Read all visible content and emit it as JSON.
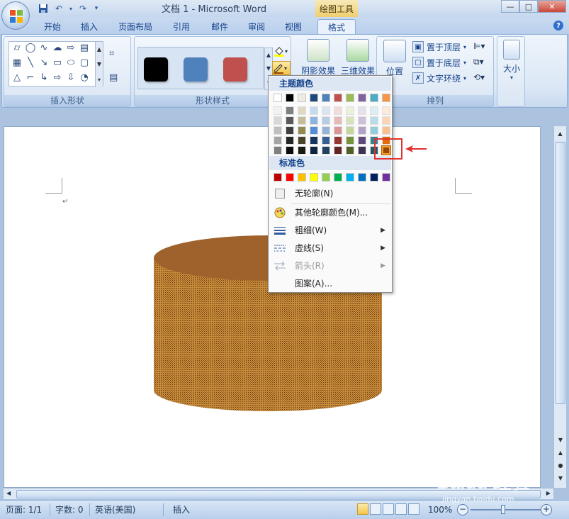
{
  "window": {
    "title": "文档 1 - Microsoft Word",
    "context_tab_title": "绘图工具",
    "controls": [
      "—",
      "□",
      "✕"
    ]
  },
  "tabs": [
    {
      "label": "开始"
    },
    {
      "label": "插入"
    },
    {
      "label": "页面布局"
    },
    {
      "label": "引用"
    },
    {
      "label": "邮件"
    },
    {
      "label": "审阅"
    },
    {
      "label": "视图"
    },
    {
      "label": "格式"
    }
  ],
  "ribbon": {
    "insert_shapes_label": "插入形状",
    "shape_styles_label": "形状样式",
    "arrange_label": "排列",
    "shadow_effects": "阴影效果",
    "threed_effects": "三维效果",
    "position": "位置",
    "bring_to_front": "置于顶层",
    "send_to_back": "置于底层",
    "text_wrapping": "文字环绕",
    "size": "大小",
    "style_swatches": [
      "#000000",
      "#4f81bd",
      "#c0504d"
    ]
  },
  "outline_menu": {
    "theme_colors_header": "主题颜色",
    "standard_colors_header": "标准色",
    "theme_top_row": [
      "#ffffff",
      "#000000",
      "#eeece1",
      "#1f497d",
      "#4f81bd",
      "#c0504d",
      "#9bbb59",
      "#8064a2",
      "#4bacc6",
      "#f79646"
    ],
    "theme_columns": [
      [
        "#f2f2f2",
        "#d8d8d8",
        "#bfbfbf",
        "#a5a5a5",
        "#7f7f7f"
      ],
      [
        "#7f7f7f",
        "#595959",
        "#3f3f3f",
        "#262626",
        "#0c0c0c"
      ],
      [
        "#ddd9c3",
        "#c4bd97",
        "#938953",
        "#494429",
        "#1d1b10"
      ],
      [
        "#c6d9f0",
        "#8db3e2",
        "#548dd4",
        "#17365d",
        "#0f243e"
      ],
      [
        "#dbe5f1",
        "#b8cce4",
        "#95b3d7",
        "#366092",
        "#244061"
      ],
      [
        "#f2dcdb",
        "#e5b9b7",
        "#d99694",
        "#953734",
        "#632423"
      ],
      [
        "#ebf1dd",
        "#d7e3bc",
        "#c3d69b",
        "#76923c",
        "#4f6128"
      ],
      [
        "#e5e0ec",
        "#ccc1d9",
        "#b2a2c7",
        "#5f497a",
        "#3f3151"
      ],
      [
        "#dbeef3",
        "#b7dde8",
        "#92cddc",
        "#31859b",
        "#205867"
      ],
      [
        "#fdeada",
        "#fbd5b5",
        "#fac08f",
        "#e36c09",
        "#974806"
      ]
    ],
    "standard_colors": [
      "#c00000",
      "#ff0000",
      "#ffc000",
      "#ffff00",
      "#92d050",
      "#00b050",
      "#00b0f0",
      "#0070c0",
      "#002060",
      "#7030a0"
    ],
    "no_outline": "无轮廓(N)",
    "more_colors": "其他轮廓颜色(M)...",
    "weight": "粗细(W)",
    "dashes": "虚线(S)",
    "arrows": "箭头(R)",
    "pattern": "图案(A)...",
    "selected_color": "#974806"
  },
  "document": {
    "cylinder_fill": "#a0622d"
  },
  "status": {
    "page": "页面: 1/1",
    "words": "字数: 0",
    "language": "英语(美国)",
    "mode": "插入",
    "zoom": "100%"
  },
  "watermark": {
    "brand": "Baidu 经验",
    "url": "jingyan.baidu.com"
  }
}
